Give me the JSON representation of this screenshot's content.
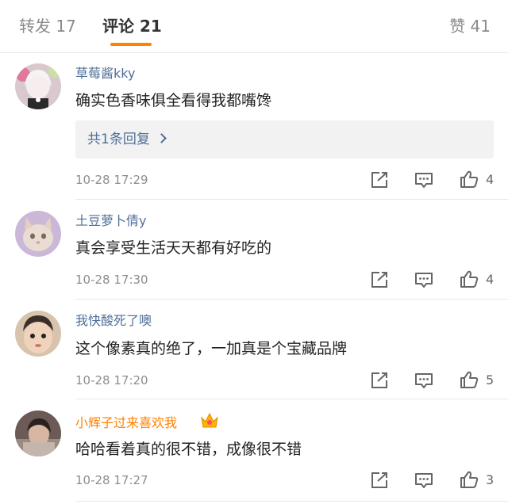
{
  "tabs": {
    "repost": "转发 17",
    "comments": "评论 21",
    "likes": "赞 41"
  },
  "colors": {
    "accent": "#ff8200",
    "username": "#4f6f99"
  },
  "comments": [
    {
      "username": "草莓酱kky",
      "content": "确实色香味俱全看得我都嘴馋",
      "reply_link": "共1条回复",
      "time": "10-28 17:29",
      "likes": "4"
    },
    {
      "username": "土豆萝卜倩y",
      "content": "真会享受生活天天都有好吃的",
      "time": "10-28 17:30",
      "likes": "4"
    },
    {
      "username": "我快酸死了噢",
      "content": "这个像素真的绝了，一加真是个宝藏品牌",
      "time": "10-28 17:20",
      "likes": "5"
    },
    {
      "username": "小辉子过来喜欢我",
      "content": "哈哈看着真的很不错，成像很不错",
      "time": "10-28 17:27",
      "likes": "3"
    }
  ],
  "icons": {
    "share": "share-icon",
    "reply": "comment-icon",
    "like": "thumbs-up-icon",
    "badge": "crown-icon"
  }
}
